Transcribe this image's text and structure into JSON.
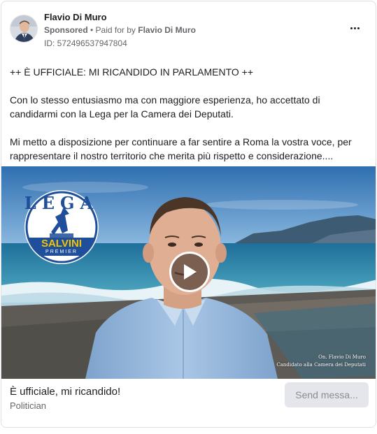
{
  "post": {
    "author": "Flavio Di Muro",
    "sponsored_label": "Sponsored",
    "separator": " • ",
    "paid_for_prefix": "Paid for by ",
    "paid_for_name": "Flavio Di Muro",
    "ad_id": "ID: 572496537947804",
    "more_icon": "more-horizontal-icon"
  },
  "body": {
    "paragraphs": [
      "++ È UFFICIALE: MI RICANDIDO IN PARLAMENTO ++",
      "Con lo stesso entusiasmo ma con maggiore esperienza, ho accettato di candidarmi con la Lega per la Camera dei Deputati.",
      "Mi metto a disposizione per continuare a far sentire a Roma la vostra voce, per rappresentare il nostro territorio che merita più rispetto e considerazione...."
    ]
  },
  "media": {
    "logo": {
      "top_text": "LEGA",
      "band_text": "SALVINI",
      "bottom_text": "PREMIER"
    },
    "caption_line1": "On. Flavio Di Muro",
    "caption_line2": "Candidato alla Camera dei Deputati",
    "play_icon": "play-icon"
  },
  "cta": {
    "title": "È ufficiale, mi ricandido!",
    "subtitle": "Politician",
    "button_label": "Send messa..."
  },
  "colors": {
    "sky": "#3f80bd",
    "sea": "#2f7fa6",
    "logo_blue": "#1f4e9a",
    "logo_yellow": "#f2c500",
    "shirt": "#8fb2d8",
    "button_bg": "#e4e6eb"
  }
}
